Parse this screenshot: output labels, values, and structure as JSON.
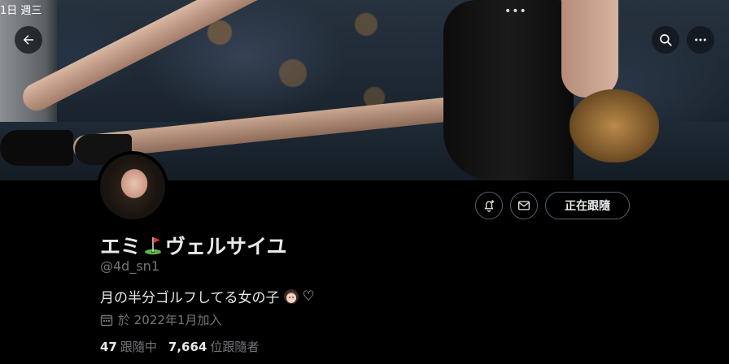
{
  "status_bar": {
    "time": "1日 週三"
  },
  "banner": {
    "pager": "•••"
  },
  "header": {
    "back_icon": "arrow-left-icon",
    "search_icon": "search-icon",
    "more_icon": "more-horizontal-icon"
  },
  "profile": {
    "name_part1": "エミ",
    "name_part2": "ヴェルサイユ",
    "name_emoji_icon": "golf-flag-icon",
    "handle": "@4d_sn1",
    "bio_text": "月の半分ゴルフしてる女の子",
    "bio_emoji_icon": "girl-face-icon",
    "bio_heart": "♡",
    "joined_text": "於 2022年1月加入",
    "following_count": "47",
    "following_label": "跟隨中",
    "followers_count": "7,664",
    "followers_label": "位跟隨者"
  },
  "actions": {
    "notify_icon": "bell-plus-icon",
    "message_icon": "mail-icon",
    "following_button_label": "正在跟隨"
  },
  "colors": {
    "background": "#000000",
    "text_primary": "#e7e9ea",
    "text_secondary": "#71767b",
    "border": "#536471"
  }
}
